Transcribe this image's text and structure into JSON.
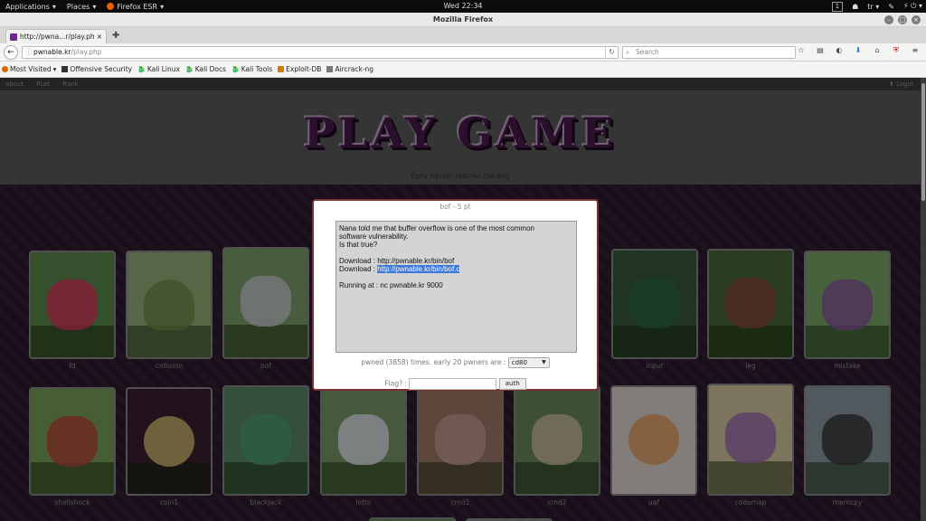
{
  "topbar": {
    "applications": "Applications",
    "places": "Places",
    "firefox": "Firefox ESR",
    "clock": "Wed 22:34",
    "workspace": "1",
    "lang": "tr"
  },
  "window": {
    "title": "Mozilla Firefox"
  },
  "tab": {
    "title": "http://pwna...r/play.php"
  },
  "navbar": {
    "url_host": "pwnable.kr",
    "url_path": "/play.php",
    "search_placeholder": "Search"
  },
  "bookmarks": [
    {
      "label": "Most Visited",
      "icon": "gear-icon"
    },
    {
      "label": "Offensive Security",
      "icon": "offsec-icon"
    },
    {
      "label": "Kali Linux",
      "icon": "kali-icon"
    },
    {
      "label": "Kali Docs",
      "icon": "kali-icon"
    },
    {
      "label": "Kali Tools",
      "icon": "kali-icon"
    },
    {
      "label": "Exploit-DB",
      "icon": "exploit-db-icon"
    },
    {
      "label": "Aircrack-ng",
      "icon": "aircrack-icon"
    }
  ],
  "site": {
    "nav": [
      "about",
      "PLet",
      "Rank"
    ],
    "login": "Login",
    "title": "PLAY GAME",
    "subtitle": "Early hacker catches the bug"
  },
  "cards_row1": [
    "fd",
    "collision",
    "bof",
    "",
    "",
    "",
    "input",
    "leg",
    "mistake"
  ],
  "cards_row2": [
    "shellshock",
    "coin1",
    "blackjack",
    "lotto",
    "cmd1",
    "cmd2",
    "uaf",
    "codemap",
    "memcpy"
  ],
  "modal": {
    "title": "bof - 5 pt",
    "line1": "Nana told me that buffer overflow is one of the most common",
    "line2": "software vulnerability.",
    "line3": "Is that true?",
    "dl1_label": "Download : ",
    "dl1_url": "http://pwnable.kr/bin/bof",
    "dl2_label": "Download : ",
    "dl2_url": "http://pwnable.kr/bin/bof.c",
    "running": "Running at : nc pwnable.kr 9000",
    "pwned_text": "pwned (3858) times. early 20 pwners are : ",
    "pwner_selected": "cd80",
    "flag_label": "Flag? : ",
    "auth_label": "auth"
  },
  "colors": {
    "accent_purple": "#4a1c4e",
    "modal_border": "#7a3030",
    "selection": "#3b78d8"
  }
}
